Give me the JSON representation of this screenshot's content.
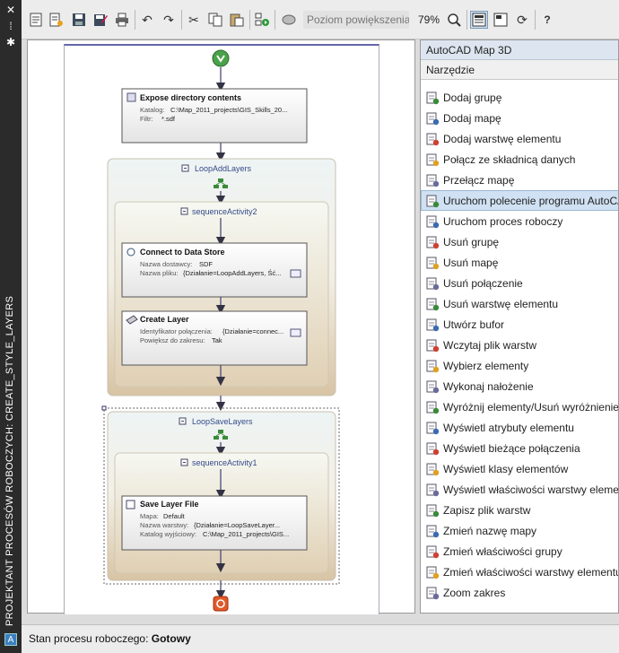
{
  "sidebar": {
    "title": "PROJEKTANT PROCESÓW ROBOCZYCH: CREATE_STYLE_LAYERS",
    "icons": [
      "close-icon",
      "pin-icon",
      "settings-icon"
    ],
    "app_icon": "A"
  },
  "toolbar": {
    "buttons": [
      "new-icon",
      "new-from-template-icon",
      "save-icon",
      "save-as-icon",
      "print-icon",
      "undo-icon",
      "redo-icon",
      "cut-icon",
      "copy-icon",
      "paste-icon",
      "run-icon",
      "zoom-tool-icon",
      "zoom-fit-icon",
      "view-toggle-icon",
      "properties-icon",
      "refresh-icon",
      "help-icon"
    ],
    "zoom_label": "Poziom powiększenia",
    "zoom_value": "79%"
  },
  "workflow": {
    "expose": {
      "title": "Expose directory contents",
      "rows": [
        {
          "label": "Katalog:",
          "value": "C:\\Map_2011_projects\\GIS_Skills_20..."
        },
        {
          "label": "Filtr:",
          "value": "*.sdf"
        }
      ]
    },
    "loop_add": "LoopAddLayers",
    "seq2": "sequenceActivity2",
    "connect": {
      "title": "Connect to Data Store",
      "rows": [
        {
          "label": "Nazwa dostawcy:",
          "value": "SDF"
        },
        {
          "label": "Nazwa pliku:",
          "value": "{Działanie=LoopAddLayers, Ść..."
        }
      ]
    },
    "create_layer": {
      "title": "Create Layer",
      "rows": [
        {
          "label": "Identyfikator połączenia:",
          "value": "{Działanie=connec..."
        },
        {
          "label": "Powiększ do zakresu:",
          "value": "Tak"
        }
      ]
    },
    "loop_save": "LoopSaveLayers",
    "seq1": "sequenceActivity1",
    "save_file": {
      "title": "Save Layer File",
      "rows": [
        {
          "label": "Mapa:",
          "value": "Default"
        },
        {
          "label": "Nazwa warstwy:",
          "value": "{Działanie=LoopSaveLayer..."
        },
        {
          "label": "Katalog wyjściowy:",
          "value": "C:\\Map_2011_projects\\GIS..."
        }
      ]
    }
  },
  "panel": {
    "title": "AutoCAD Map 3D",
    "subtitle": "Narzędzie",
    "items": [
      {
        "label": "Dodaj grupę",
        "icon": "add-group-icon"
      },
      {
        "label": "Dodaj mapę",
        "icon": "add-map-icon"
      },
      {
        "label": "Dodaj warstwę elementu",
        "icon": "add-feature-layer-icon"
      },
      {
        "label": "Połącz ze składnicą danych",
        "icon": "connect-data-store-icon"
      },
      {
        "label": "Przełącz mapę",
        "icon": "switch-map-icon"
      },
      {
        "label": "Uruchom polecenie programu AutoCAD",
        "icon": "run-command-icon"
      },
      {
        "label": "Uruchom proces roboczy",
        "icon": "run-workflow-icon"
      },
      {
        "label": "Usuń grupę",
        "icon": "remove-group-icon"
      },
      {
        "label": "Usuń mapę",
        "icon": "remove-map-icon"
      },
      {
        "label": "Usuń połączenie",
        "icon": "remove-connection-icon"
      },
      {
        "label": "Usuń warstwę elementu",
        "icon": "remove-feature-layer-icon"
      },
      {
        "label": "Utwórz bufor",
        "icon": "create-buffer-icon"
      },
      {
        "label": "Wczytaj plik warstw",
        "icon": "load-layer-file-icon"
      },
      {
        "label": "Wybierz elementy",
        "icon": "select-features-icon"
      },
      {
        "label": "Wykonaj nałożenie",
        "icon": "overlay-icon"
      },
      {
        "label": "Wyróżnij elementy/Usuń wyróżnienie",
        "icon": "highlight-features-icon"
      },
      {
        "label": "Wyświetl atrybuty elementu",
        "icon": "feature-attributes-icon"
      },
      {
        "label": "Wyświetl bieżące połączenia",
        "icon": "current-connections-icon"
      },
      {
        "label": "Wyświetl klasy elementów",
        "icon": "feature-classes-icon"
      },
      {
        "label": "Wyświetl właściwości warstwy elementu",
        "icon": "layer-properties-icon"
      },
      {
        "label": "Zapisz plik warstw",
        "icon": "save-layer-file-icon"
      },
      {
        "label": "Zmień nazwę mapy",
        "icon": "rename-map-icon"
      },
      {
        "label": "Zmień właściwości grupy",
        "icon": "group-properties-icon"
      },
      {
        "label": "Zmień właściwości warstwy elementu",
        "icon": "change-layer-properties-icon"
      },
      {
        "label": "Zoom zakres",
        "icon": "zoom-extents-icon"
      }
    ],
    "selected_index": 5
  },
  "status": {
    "label": "Stan procesu roboczego:",
    "value": "Gotowy"
  }
}
